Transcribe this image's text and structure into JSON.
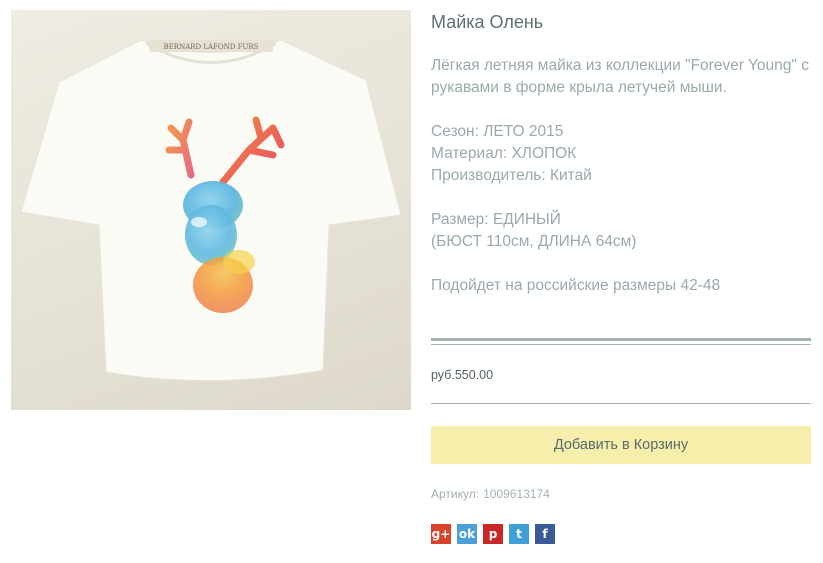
{
  "product": {
    "title": "Майка Олень",
    "description": [
      "Лёгкая летняя майка из коллекции \"Forever Young\" с рукавами в форме крыла летучей мыши.",
      "",
      "Сезон: ЛЕТО 2015",
      "Материал: ХЛОПОК",
      "Производитель: Китай",
      "",
      "Размер: ЕДИНЫЙ",
      "(БЮСТ 110см, ДЛИНА 64см)",
      "",
      "Подойдет на российские размеры 42-48"
    ],
    "price": "руб.550.00",
    "add_to_cart_label": "Добавить в Корзину",
    "sku_label": "Артикул:",
    "sku_value": "1009613174",
    "image_neck_label_text": "BERNARD LAFOND FURS"
  },
  "social": [
    {
      "name": "google-plus",
      "glyph": "g+",
      "color": "#d8432c"
    },
    {
      "name": "odnoklassniki",
      "glyph": "ok",
      "color": "#4c9fd9"
    },
    {
      "name": "pinterest",
      "glyph": "p",
      "color": "#c82828"
    },
    {
      "name": "twitter",
      "glyph": "t",
      "color": "#3f9fd8"
    },
    {
      "name": "facebook",
      "glyph": "f",
      "color": "#3b5b98"
    }
  ]
}
